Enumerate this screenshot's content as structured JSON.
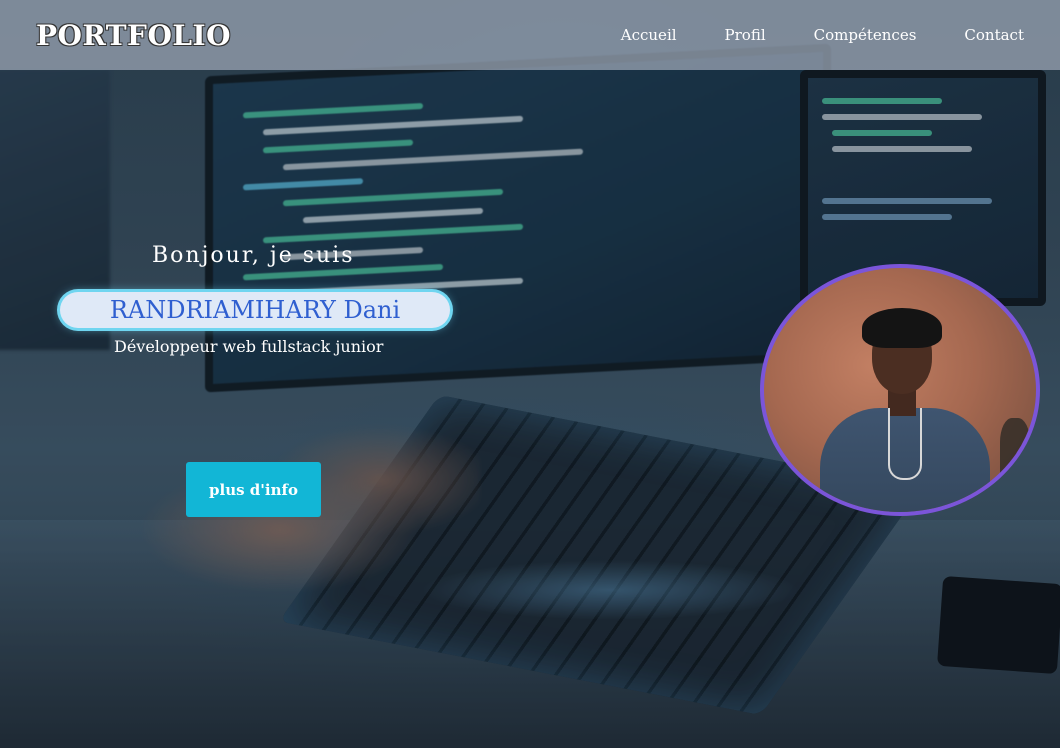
{
  "header": {
    "logo": "PORTFOLIO",
    "nav": [
      "Accueil",
      "Profil",
      "Compétences",
      "Contact"
    ]
  },
  "hero": {
    "greeting": "Bonjour, je suis",
    "name": "RANDRIAMIHARY Dani",
    "role": "Développeur web fullstack junior",
    "button_label": "plus d'info"
  },
  "colors": {
    "header_bg": "#969faf",
    "name_text": "#2f5fd0",
    "name_pill_glow": "#6fd5f0",
    "button_bg": "#12b6d6",
    "avatar_border": "#7b55d9"
  },
  "icons": {
    "avatar": "profile-photo"
  }
}
